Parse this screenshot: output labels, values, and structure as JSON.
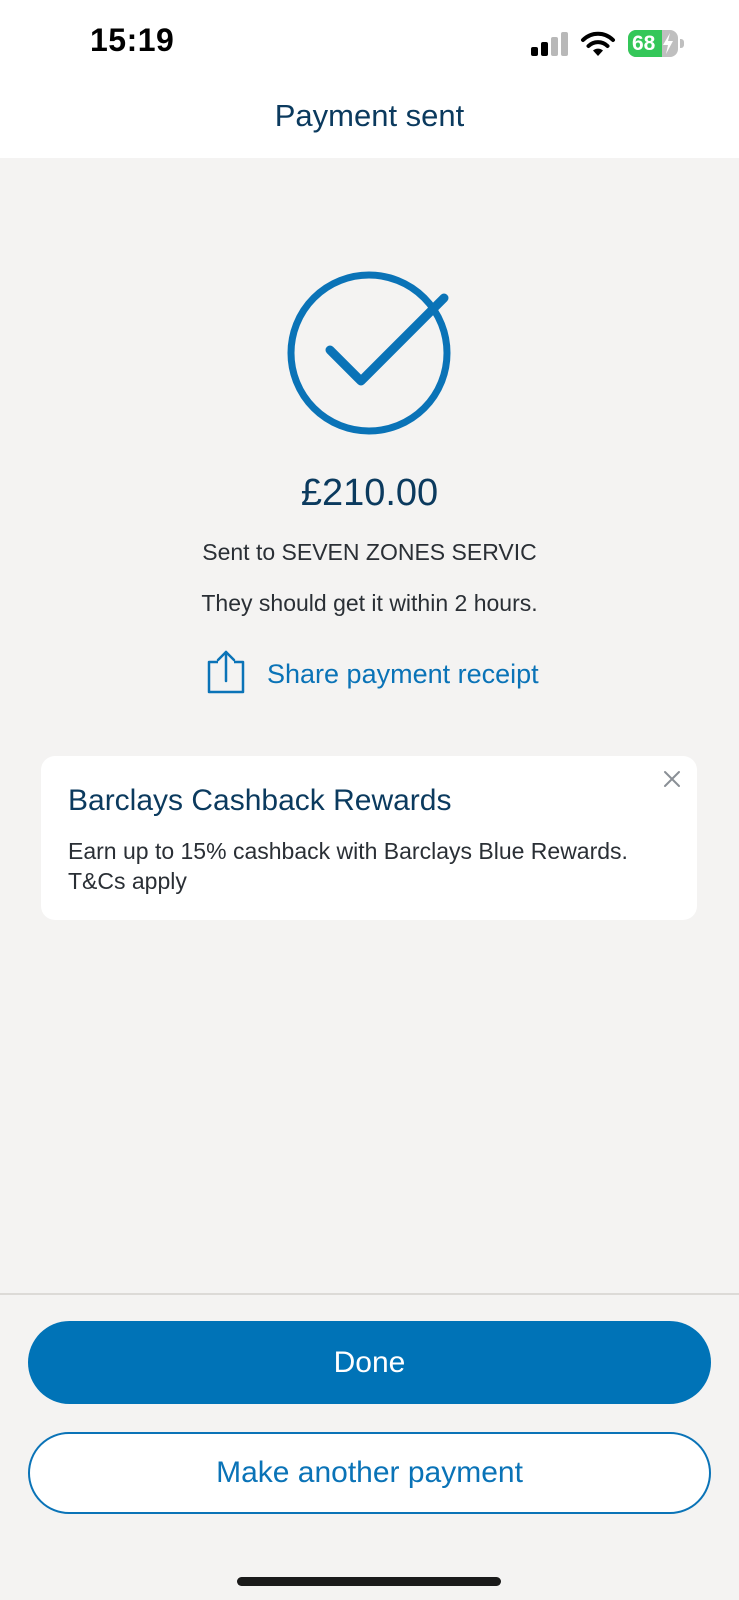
{
  "status_bar": {
    "time": "15:19",
    "battery_level": "68",
    "battery_charging": true,
    "signal_icon": "cellular-signal-icon",
    "wifi_icon": "wifi-icon"
  },
  "header": {
    "title": "Payment sent"
  },
  "confirmation": {
    "icon": "checkmark-circle-icon",
    "amount": "£210.00",
    "recipient_line": "Sent to SEVEN ZONES SERVIC",
    "eta_line": "They should get it within 2 hours.",
    "share_label": "Share payment receipt",
    "share_icon": "share-icon"
  },
  "promo": {
    "title": "Barclays Cashback Rewards",
    "body": "Earn up to 15% cashback with Barclays Blue Rewards. T&Cs apply",
    "close_icon": "close-icon"
  },
  "actions": {
    "primary_label": "Done",
    "secondary_label": "Make another payment"
  },
  "colors": {
    "brand_blue": "#0073b7",
    "title_navy": "#0b3a5e",
    "background": "#f4f3f2",
    "battery_green": "#34c759"
  }
}
